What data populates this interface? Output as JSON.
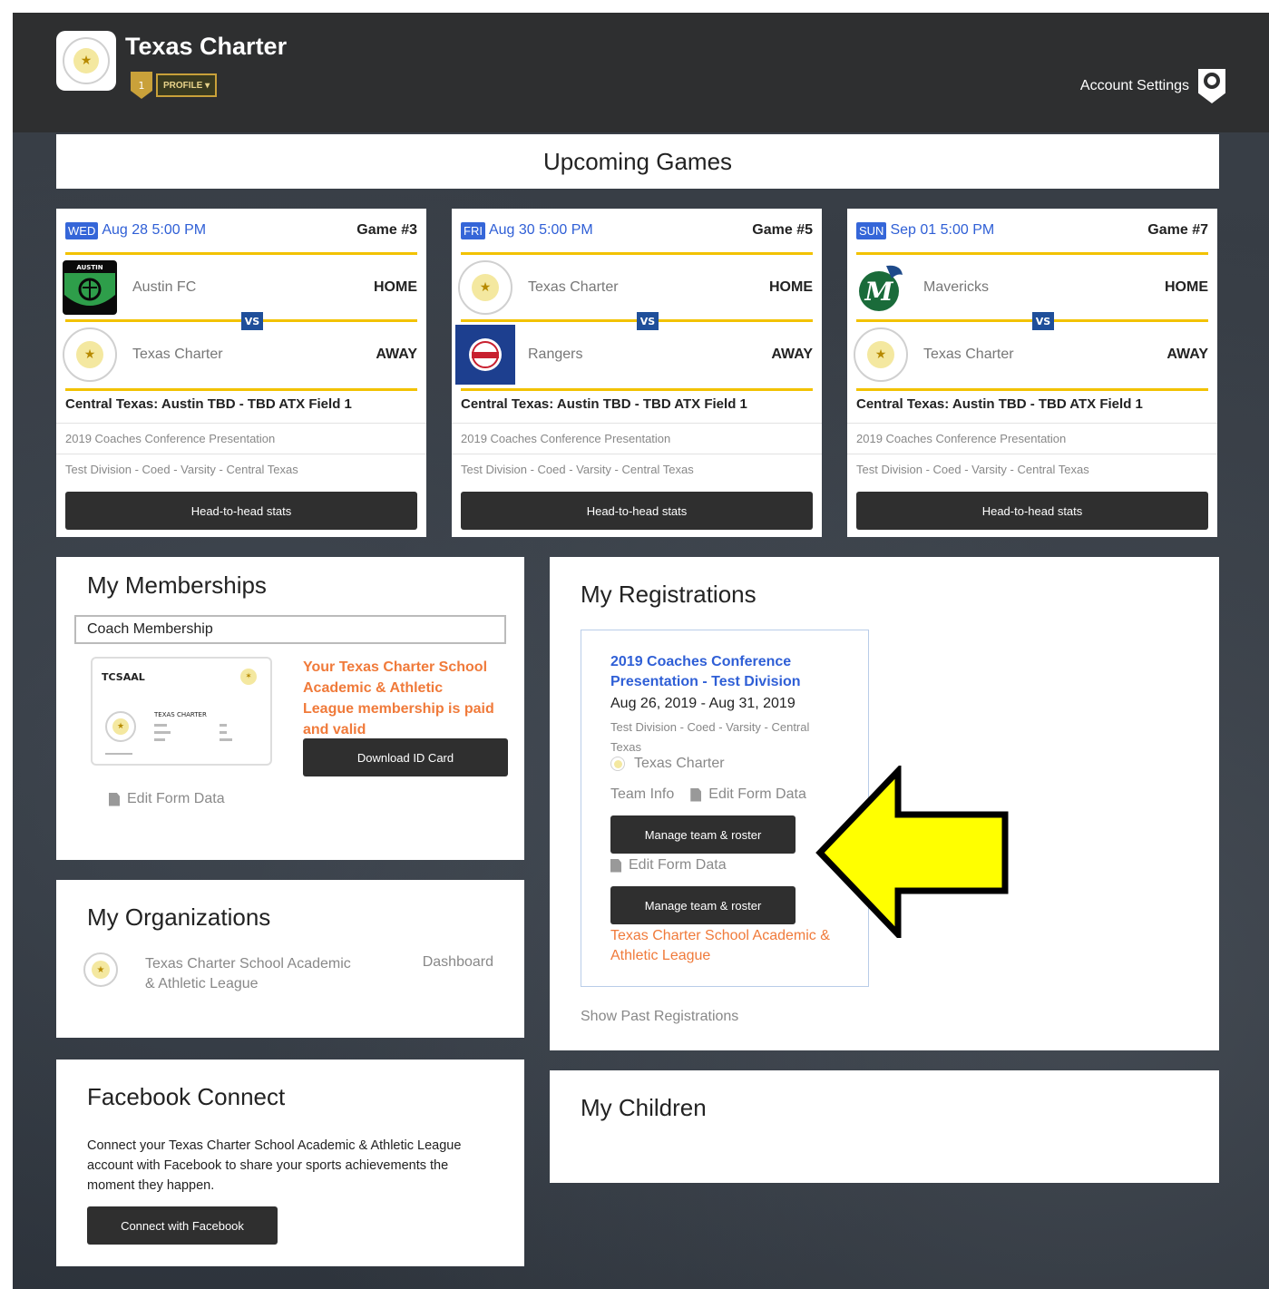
{
  "header": {
    "org_title": "Texas Charter",
    "profile_label": "PROFILE ▾",
    "account_settings": "Account Settings"
  },
  "upcoming": {
    "title": "Upcoming Games",
    "games": [
      {
        "day": "WED",
        "date": "Aug 28 5:00 PM",
        "game": "Game #3",
        "home_team": "Austin FC",
        "home_label": "HOME",
        "away_team": "Texas Charter",
        "away_label": "AWAY",
        "vs": "VS",
        "location": "Central Texas: Austin TBD - TBD ATX Field 1",
        "event": "2019 Coaches Conference Presentation",
        "division": "Test Division - Coed - Varsity - Central Texas",
        "button": "Head-to-head stats"
      },
      {
        "day": "FRI",
        "date": "Aug 30 5:00 PM",
        "game": "Game #5",
        "home_team": "Texas Charter",
        "home_label": "HOME",
        "away_team": "Rangers",
        "away_label": "AWAY",
        "vs": "VS",
        "location": "Central Texas: Austin TBD - TBD ATX Field 1",
        "event": "2019 Coaches Conference Presentation",
        "division": "Test Division - Coed - Varsity - Central Texas",
        "button": "Head-to-head stats"
      },
      {
        "day": "SUN",
        "date": "Sep 01 5:00 PM",
        "game": "Game #7",
        "home_team": "Mavericks",
        "home_label": "HOME",
        "away_team": "Texas Charter",
        "away_label": "AWAY",
        "vs": "VS",
        "location": "Central Texas: Austin TBD - TBD ATX Field 1",
        "event": "2019 Coaches Conference Presentation",
        "division": "Test Division - Coed - Varsity - Central Texas",
        "button": "Head-to-head stats"
      }
    ]
  },
  "memberships": {
    "title": "My Memberships",
    "selected": "Coach Membership",
    "card_org": "TCSAAL",
    "card_name": "TEXAS CHARTER",
    "status": "Your Texas Charter School Academic & Athletic League membership is paid and valid",
    "download_button": "Download ID Card",
    "edit_form": "Edit Form Data"
  },
  "organizations": {
    "title": "My Organizations",
    "org_name": "Texas Charter School Academic & Athletic League",
    "dashboard": "Dashboard"
  },
  "facebook": {
    "title": "Facebook Connect",
    "text": "Connect your Texas Charter School Academic & Athletic League account with Facebook to share your sports achievements the moment they happen.",
    "button": "Connect with Facebook"
  },
  "registrations": {
    "title": "My Registrations",
    "event_title": "2019 Coaches Conference Presentation - Test Division",
    "dates": "Aug 26, 2019 - Aug 31, 2019",
    "division": "Test Division - Coed - Varsity - Central Texas",
    "team": "Texas Charter",
    "team_info": "Team Info",
    "edit_form": "Edit Form Data",
    "manage_button_1": "Manage team & roster",
    "edit_form_2": "Edit Form Data",
    "manage_button_2": "Manage team & roster",
    "league": "Texas Charter School Academic & Athletic League",
    "show_past": "Show Past Registrations"
  },
  "children": {
    "title": "My Children"
  },
  "colors": {
    "accent_blue": "#2f5fd6",
    "gold": "#f2c200",
    "orange": "#f07a3a",
    "annotation_arrow": "#ffff00"
  }
}
